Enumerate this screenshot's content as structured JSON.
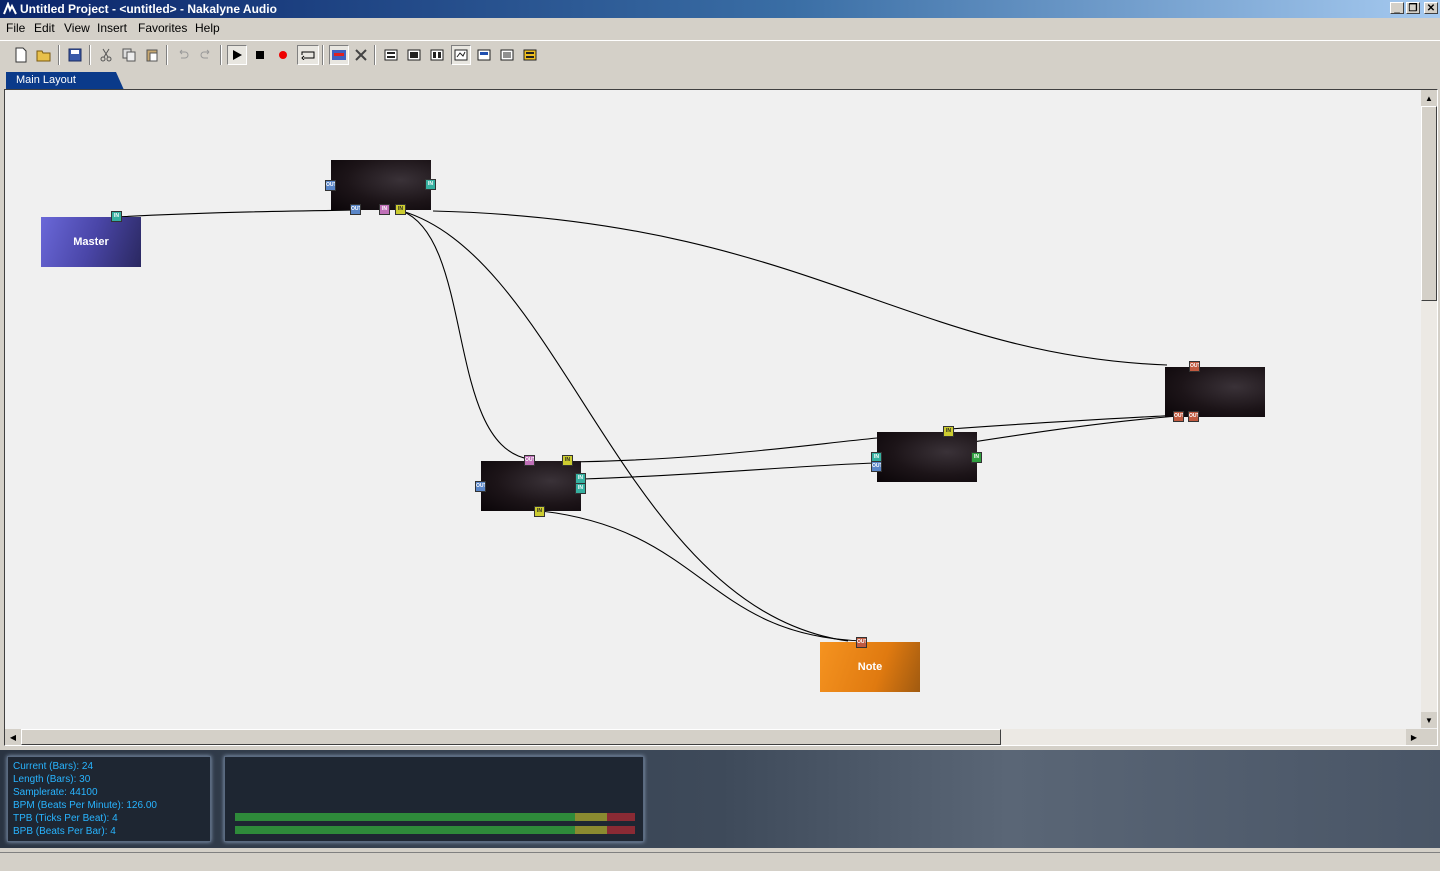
{
  "window": {
    "title": "Untitled Project - <untitled> - Nakalyne Audio"
  },
  "menu": [
    "File",
    "Edit",
    "View",
    "Insert",
    "Favorites",
    "Help"
  ],
  "toolbar": {
    "buttons": [
      "new-file",
      "open-folder",
      "save",
      "cut",
      "copy",
      "paste",
      "undo",
      "redo",
      "play",
      "stop",
      "record",
      "loop",
      "mixer",
      "tools",
      "view-1",
      "view-2",
      "view-3",
      "view-4",
      "view-5",
      "view-6",
      "view-7"
    ]
  },
  "tabs": [
    {
      "label": "Main Layout",
      "active": true
    }
  ],
  "nodes": {
    "master": {
      "label": "Master"
    },
    "note": {
      "label": "Note"
    },
    "port_labels": {
      "in": "IN",
      "out": "OUT"
    }
  },
  "info": {
    "current": "Current (Bars): 24",
    "length": "Length (Bars): 30",
    "samplerate": "Samplerate: 44100",
    "bpm": "BPM (Beats Per Minute): 126.00",
    "tpb": "TPB (Ticks Per Beat): 4",
    "bpb": "BPB (Beats Per Bar): 4"
  },
  "meters": {
    "left_level": 0.85,
    "right_level": 0.85
  },
  "colors": {
    "title_start": "#0a246a",
    "tab_active": "#0a3a8a",
    "info_text": "#28b4ff",
    "master_node": "#5a58c0",
    "note_node": "#f08a18"
  }
}
